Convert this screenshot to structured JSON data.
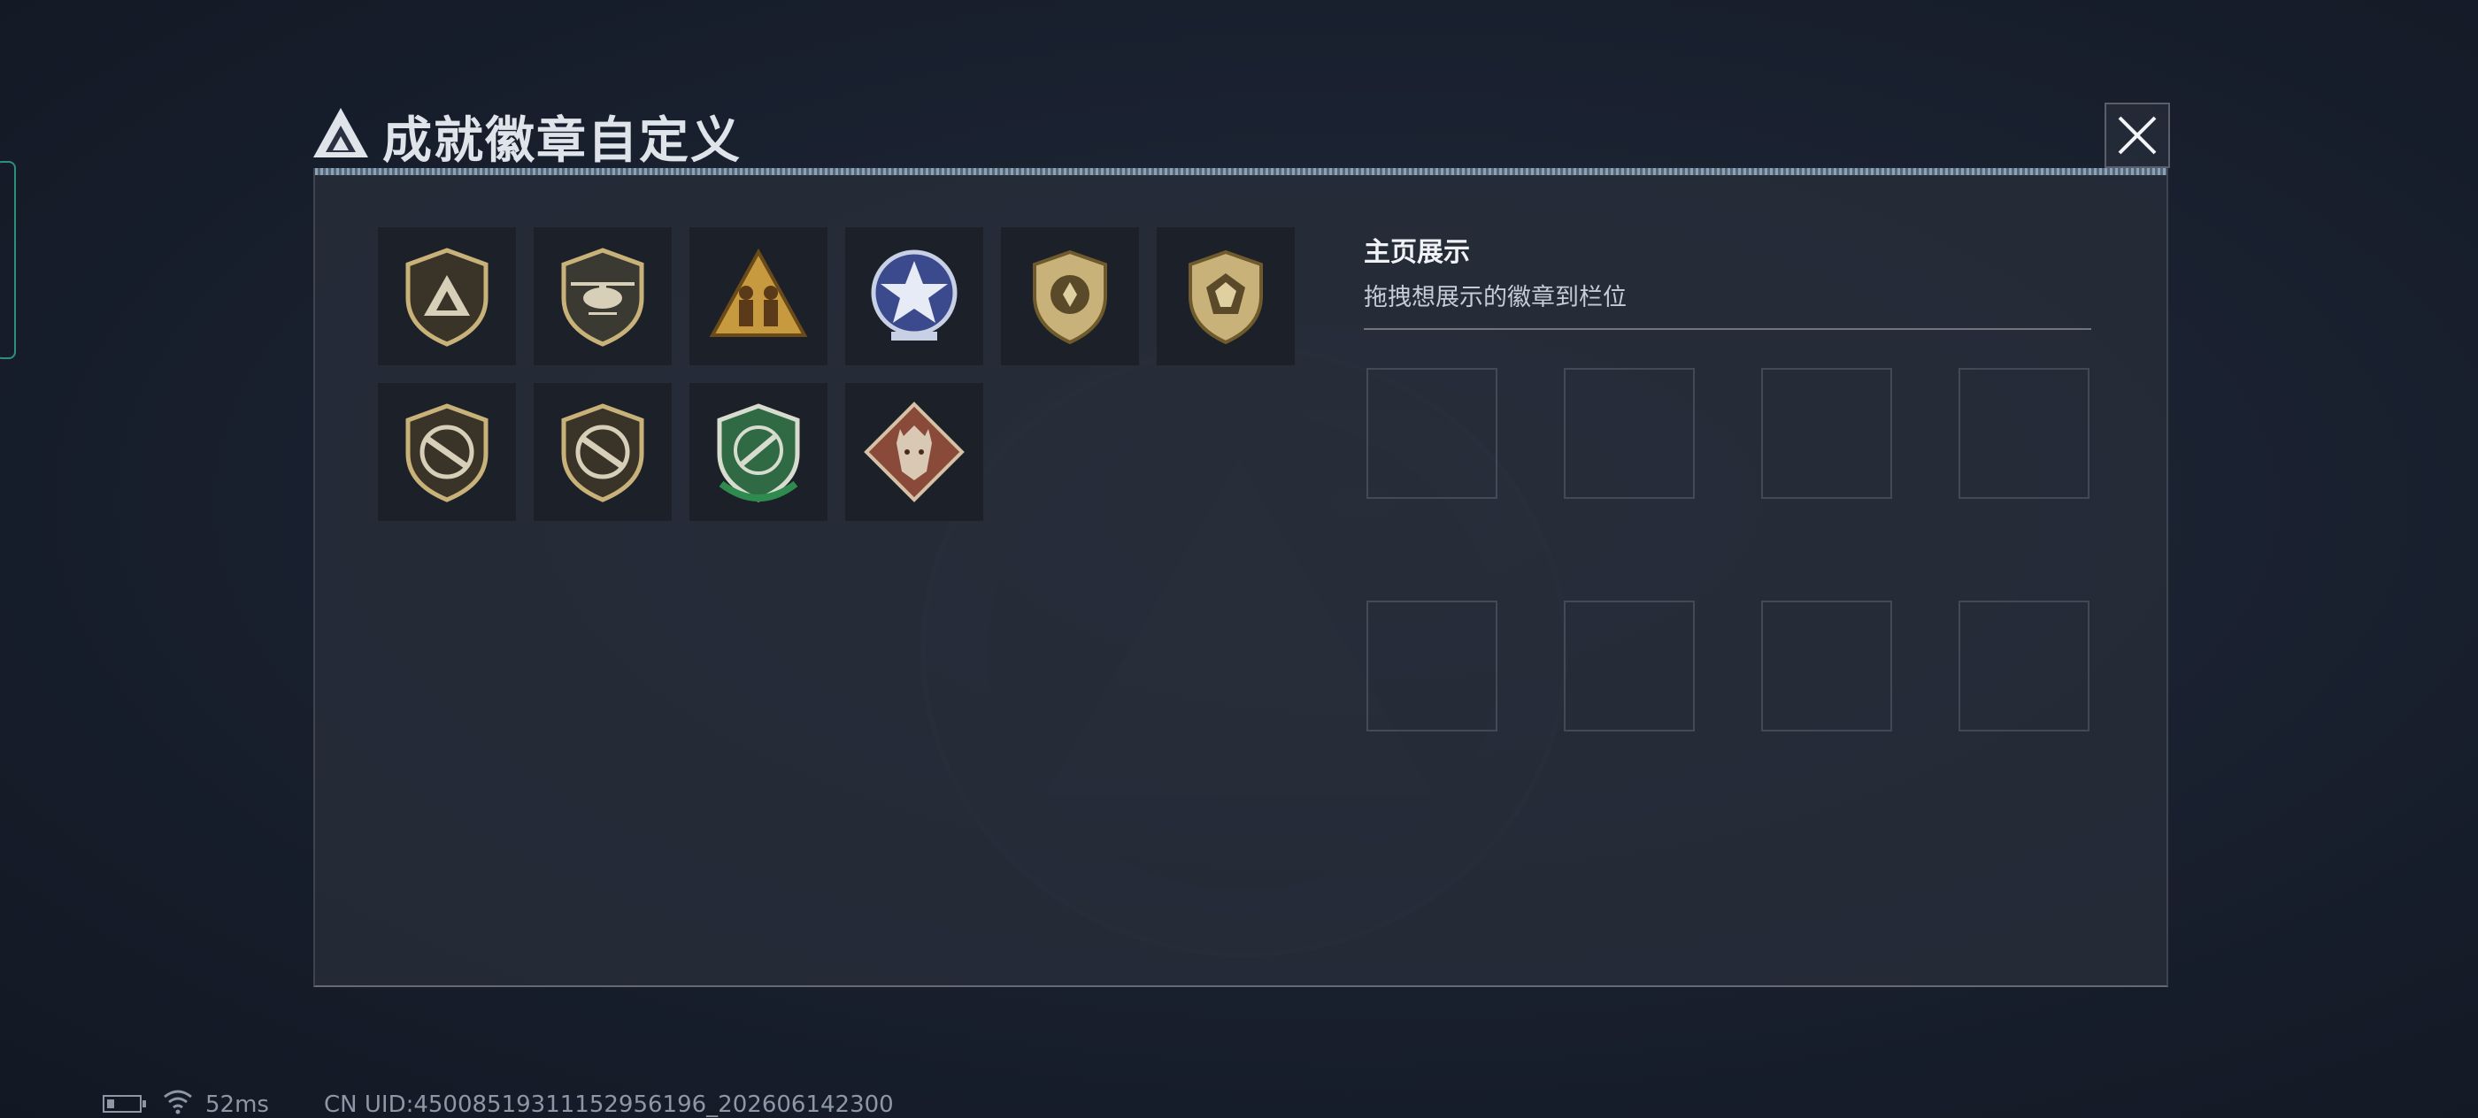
{
  "header": {
    "title": "成就徽章自定义"
  },
  "badges": [
    {
      "name": "triangle-shield-badge"
    },
    {
      "name": "helicopter-badge"
    },
    {
      "name": "soldiers-triangle-badge"
    },
    {
      "name": "star-emblem-badge"
    },
    {
      "name": "gold-shield-badge"
    },
    {
      "name": "gem-shield-badge"
    },
    {
      "name": "rifle-shield-badge"
    },
    {
      "name": "rifle-shield-badge-2"
    },
    {
      "name": "green-knife-badge"
    },
    {
      "name": "wolf-diamond-badge"
    }
  ],
  "showcase": {
    "title": "主页展示",
    "hint": "拖拽想展示的徽章到栏位",
    "slot_count": 8
  },
  "status_bar": {
    "ping": "52ms",
    "uid": "CN UID:450085193111529561­96_202606142300"
  },
  "colors": {
    "panel": "#282e3a",
    "accent_gold": "#c9b27a",
    "accent_green": "#2f8f7e"
  }
}
